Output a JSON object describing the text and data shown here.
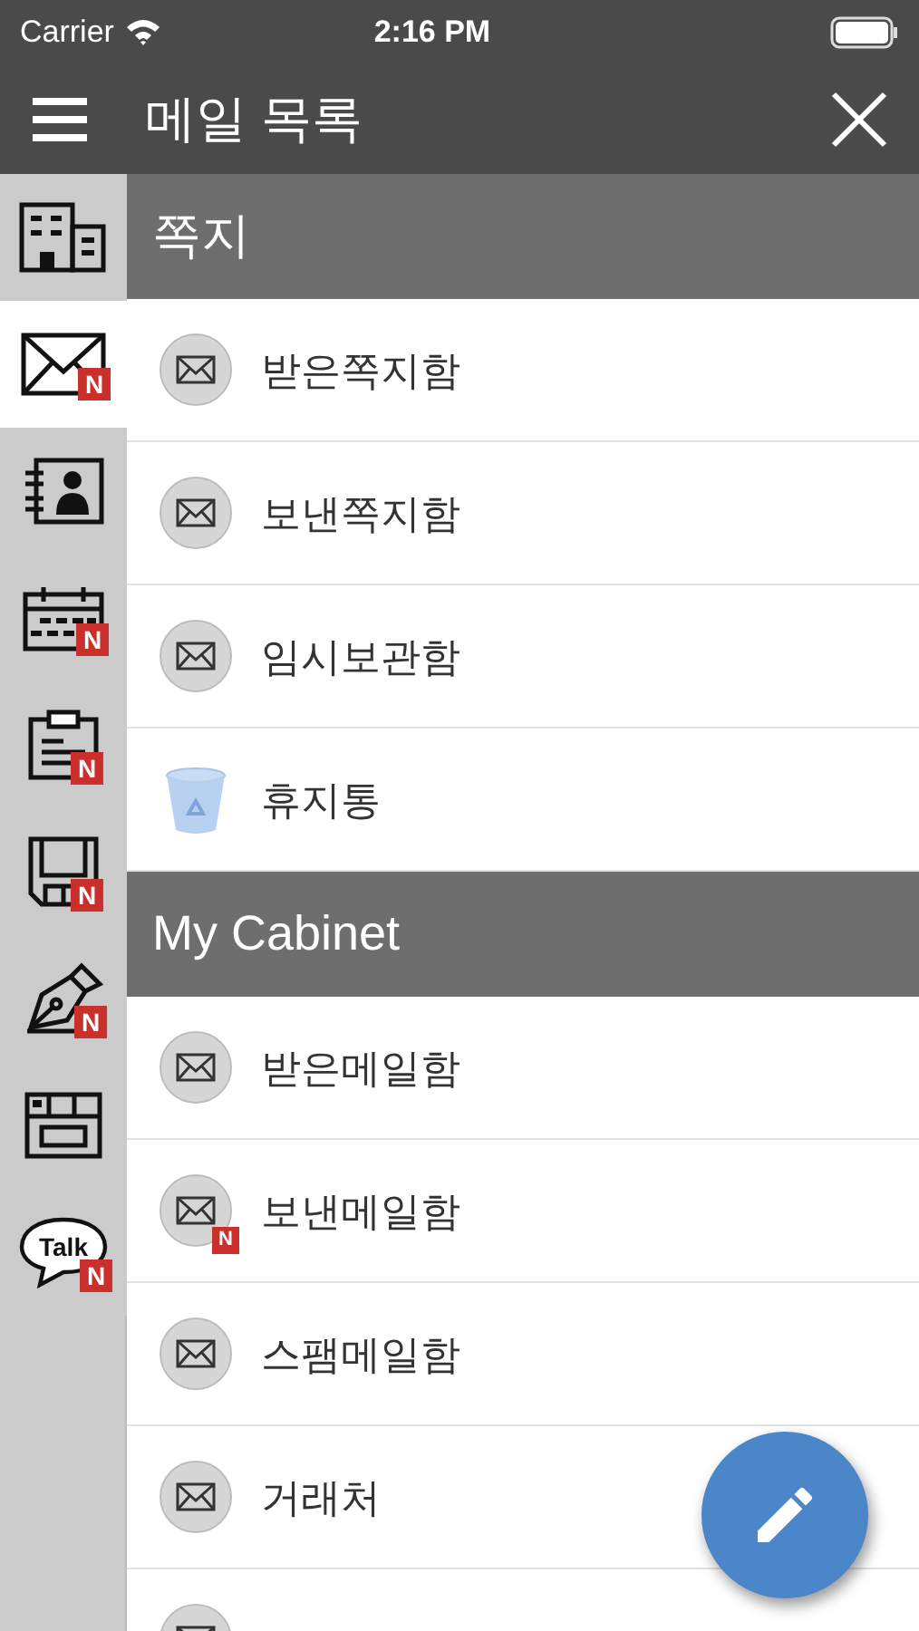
{
  "status_bar": {
    "carrier": "Carrier",
    "time": "2:16 PM"
  },
  "nav_bar": {
    "title": "메일 목록"
  },
  "sidebar": {
    "items": [
      {
        "kind": "building",
        "selected": false
      },
      {
        "kind": "mail",
        "selected": true,
        "badge": "N"
      },
      {
        "kind": "contacts",
        "selected": false
      },
      {
        "kind": "calendar",
        "selected": false,
        "badge": "N"
      },
      {
        "kind": "clipboard",
        "selected": false,
        "badge": "N"
      },
      {
        "kind": "disk",
        "selected": false,
        "badge": "N"
      },
      {
        "kind": "pen",
        "selected": false,
        "badge": "N"
      },
      {
        "kind": "board",
        "selected": false
      },
      {
        "kind": "talk",
        "selected": false,
        "badge": "N",
        "label": "Talk"
      }
    ]
  },
  "sections": [
    {
      "title": "쪽지",
      "items": [
        {
          "kind": "mail",
          "label": "받은쪽지함"
        },
        {
          "kind": "mail",
          "label": "보낸쪽지함"
        },
        {
          "kind": "mail",
          "label": "임시보관함"
        },
        {
          "kind": "trash",
          "label": "휴지통"
        }
      ]
    },
    {
      "title": "My Cabinet",
      "items": [
        {
          "kind": "mail",
          "label": "받은메일함"
        },
        {
          "kind": "mail",
          "label": "보낸메일함",
          "badge": "N"
        },
        {
          "kind": "mail",
          "label": "스팸메일함"
        },
        {
          "kind": "mail",
          "label": "거래처"
        },
        {
          "kind": "mail"
        }
      ]
    }
  ]
}
